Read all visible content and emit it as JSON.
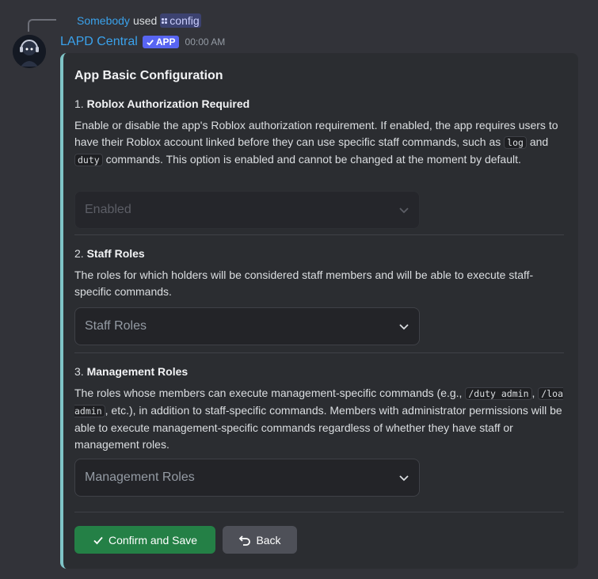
{
  "reply": {
    "user": "Somebody",
    "used": "used",
    "command": "config"
  },
  "message": {
    "bot_name": "LAPD Central",
    "app_tag": "APP",
    "timestamp": "00:00 AM"
  },
  "embed": {
    "title": "App Basic Configuration",
    "sections": [
      {
        "number": "1.",
        "heading": "Roblox Authorization Required",
        "desc_parts": [
          "Enable or disable the app's Roblox authorization requirement. If enabled, the app requires users to have their Roblox account linked before they can use specific staff commands, such as ",
          "log",
          " and ",
          "duty",
          " commands. This option is enabled and cannot be changed at the moment by default."
        ],
        "select_value": "Enabled"
      },
      {
        "number": "2.",
        "heading": "Staff Roles",
        "desc": "The roles for which holders will be considered staff members and will be able to execute staff-specific commands.",
        "select_placeholder": "Staff Roles"
      },
      {
        "number": "3.",
        "heading": "Management Roles",
        "desc_parts": [
          "The roles whose members can execute management-specific commands (e.g., ",
          "/duty admin",
          ", ",
          "/loa admin",
          ", etc.), in addition to staff-specific commands. Members with administrator permissions will be able to execute management-specific commands regardless of whether they have staff or management roles."
        ],
        "select_placeholder": "Management Roles"
      }
    ],
    "buttons": {
      "confirm": "Confirm and Save",
      "back": "Back"
    }
  },
  "colors": {
    "accent_bar": "#7fc4c7",
    "confirm_button": "#248046",
    "secondary_button": "#4e5058",
    "username": "#3aa2ec",
    "app_tag": "#5865f2"
  },
  "icons": {
    "command": "command-grid-icon",
    "app_check": "check-icon",
    "chevron": "chevron-down-icon",
    "confirm": "checkmark-icon",
    "back": "undo-arrow-icon",
    "avatar": "bot-avatar"
  }
}
